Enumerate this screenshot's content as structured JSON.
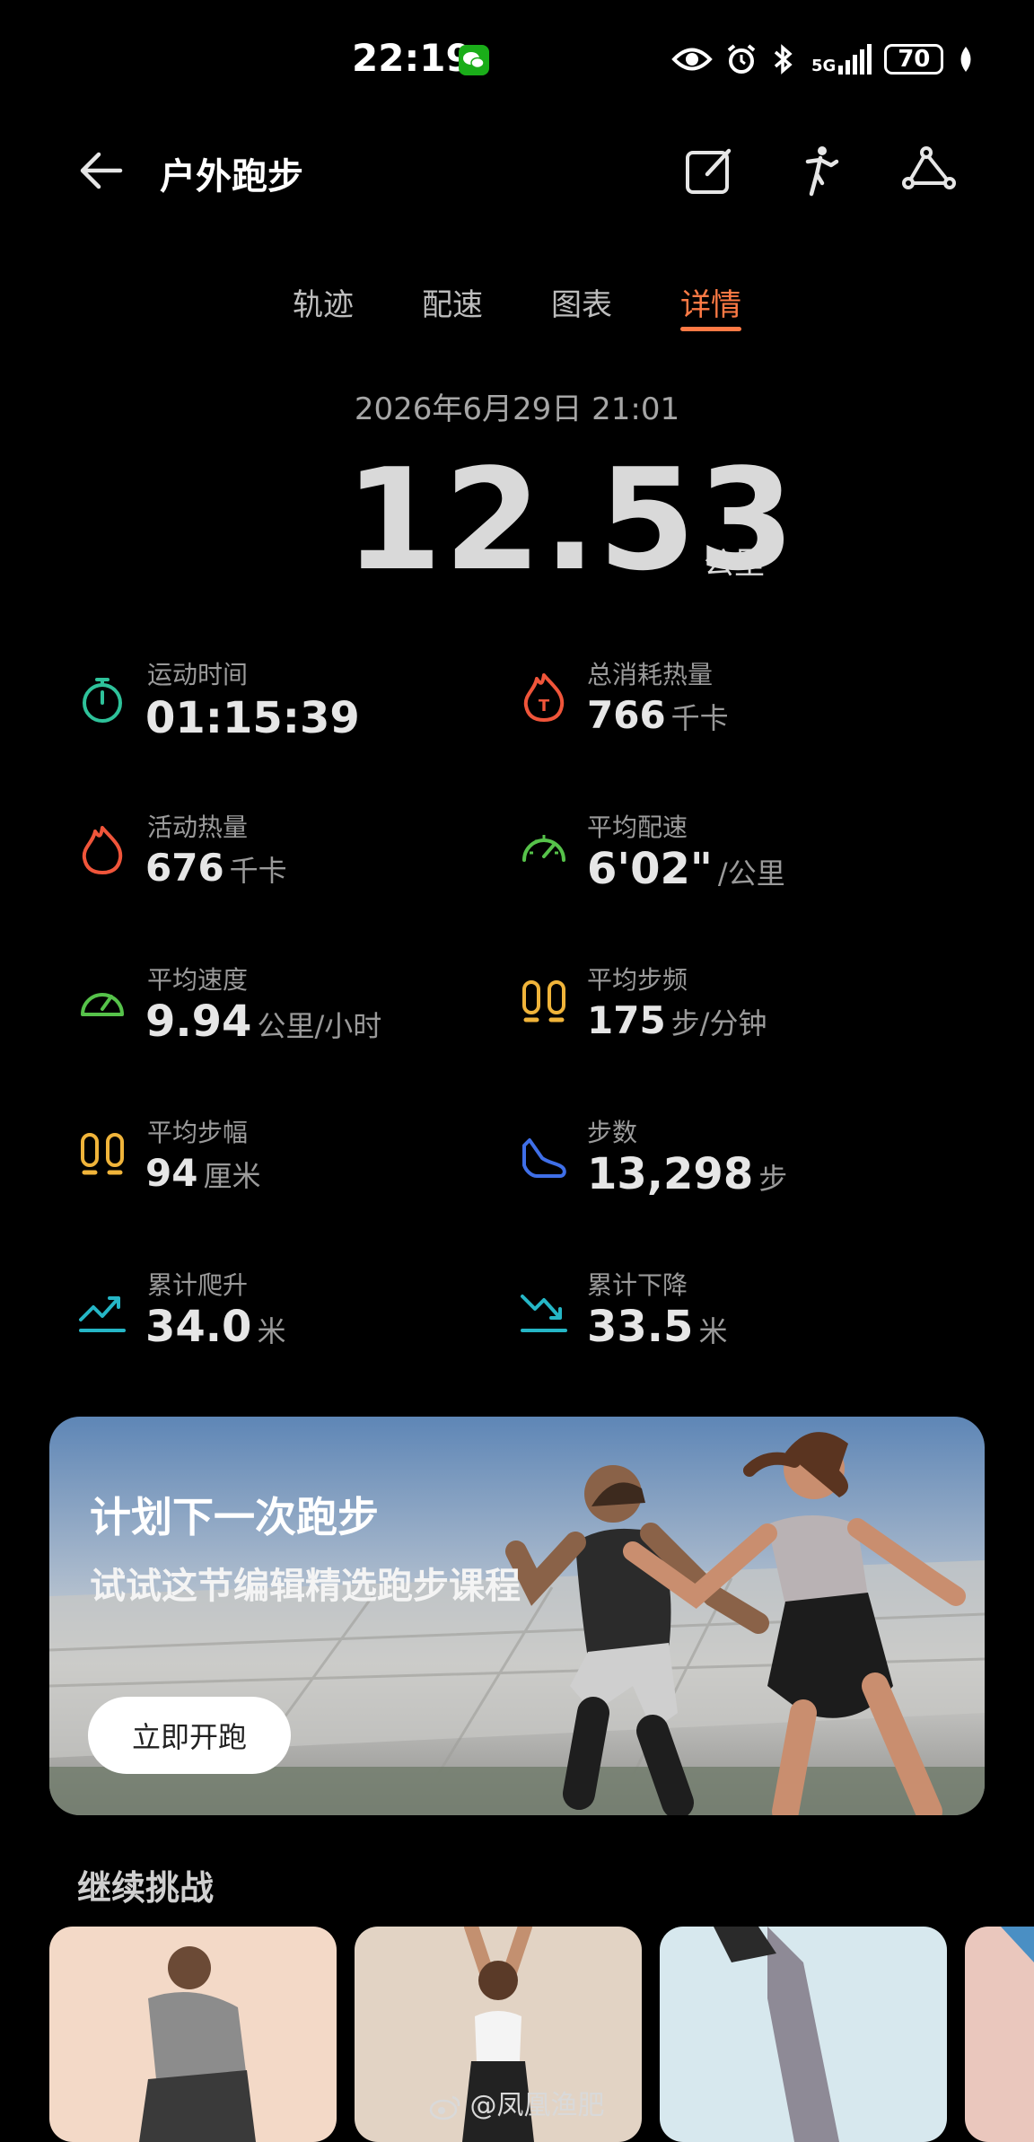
{
  "status_bar": {
    "time": "22:19",
    "battery": "70",
    "network": "5G"
  },
  "header": {
    "title": "户外跑步"
  },
  "tabs": [
    {
      "label": "轨迹"
    },
    {
      "label": "配速"
    },
    {
      "label": "图表"
    },
    {
      "label": "详情"
    }
  ],
  "summary": {
    "date": "2026年6月29日 21:01",
    "distance": "12.53",
    "distance_unit": "公里"
  },
  "stats": [
    {
      "label": "运动时间",
      "value": "01:15:39",
      "unit": "",
      "icon": "stopwatch-icon",
      "color": "#2ec29a"
    },
    {
      "label": "总消耗热量",
      "value": "766",
      "unit": "千卡",
      "icon": "flame-total-icon",
      "color": "#f0553a"
    },
    {
      "label": "活动热量",
      "value": "676",
      "unit": "千卡",
      "icon": "flame-icon",
      "color": "#f0553a"
    },
    {
      "label": "平均配速",
      "value": "6'02\"",
      "unit": "/公里",
      "icon": "speedometer-icon",
      "color": "#56c24a"
    },
    {
      "label": "平均速度",
      "value": "9.94",
      "unit": "公里/小时",
      "icon": "gauge-icon",
      "color": "#56c24a"
    },
    {
      "label": "平均步频",
      "value": "175",
      "unit": "步/分钟",
      "icon": "footprints-icon",
      "color": "#f0b43a"
    },
    {
      "label": "平均步幅",
      "value": "94",
      "unit": "厘米",
      "icon": "stride-icon",
      "color": "#f0b43a"
    },
    {
      "label": "步数",
      "value": "13,298",
      "unit": "步",
      "icon": "shoe-icon",
      "color": "#3f6fe8"
    },
    {
      "label": "累计爬升",
      "value": "34.0",
      "unit": "米",
      "icon": "ascent-icon",
      "color": "#25b6c6"
    },
    {
      "label": "累计下降",
      "value": "33.5",
      "unit": "米",
      "icon": "descent-icon",
      "color": "#25b6c6"
    }
  ],
  "banner": {
    "title": "计划下一次跑步",
    "subtitle": "试试这节编辑精选跑步课程",
    "button": "立即开跑"
  },
  "challenge": {
    "title": "继续挑战"
  },
  "watermark": "@凤凰渔肥"
}
